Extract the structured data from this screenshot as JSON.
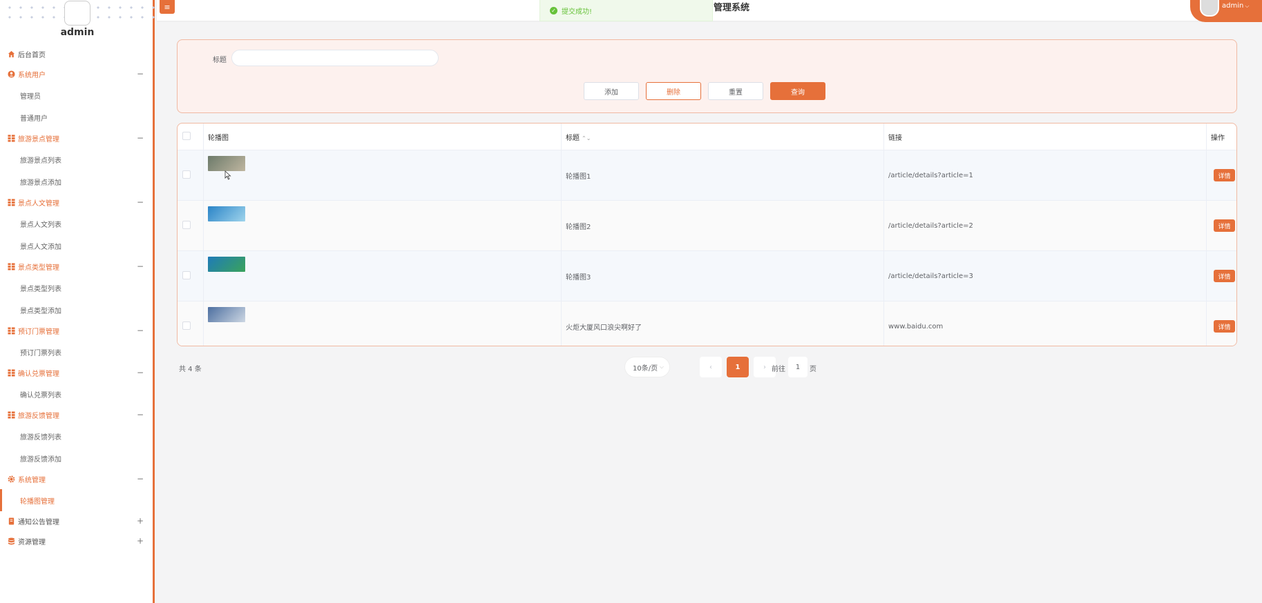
{
  "sidebar": {
    "admin_name": "admin",
    "menu": [
      {
        "type": "item",
        "label": "后台首页",
        "icon": "home-icon",
        "color": "#e6703a"
      },
      {
        "type": "group",
        "label": "系统用户",
        "icon": "user-circle-icon",
        "sign": "−"
      },
      {
        "type": "sub",
        "label": "管理员"
      },
      {
        "type": "sub",
        "label": "普通用户"
      },
      {
        "type": "group",
        "label": "旅游景点管理",
        "icon": "grid-icon",
        "sign": "−"
      },
      {
        "type": "sub",
        "label": "旅游景点列表"
      },
      {
        "type": "sub",
        "label": "旅游景点添加"
      },
      {
        "type": "group",
        "label": "景点人文管理",
        "icon": "grid-icon",
        "sign": "−"
      },
      {
        "type": "sub",
        "label": "景点人文列表"
      },
      {
        "type": "sub",
        "label": "景点人文添加"
      },
      {
        "type": "group",
        "label": "景点类型管理",
        "icon": "grid-icon",
        "sign": "−"
      },
      {
        "type": "sub",
        "label": "景点类型列表"
      },
      {
        "type": "sub",
        "label": "景点类型添加"
      },
      {
        "type": "group",
        "label": "预订门票管理",
        "icon": "grid-icon",
        "sign": "−"
      },
      {
        "type": "sub",
        "label": "预订门票列表"
      },
      {
        "type": "group",
        "label": "确认兑票管理",
        "icon": "grid-icon",
        "sign": "−"
      },
      {
        "type": "sub",
        "label": "确认兑票列表"
      },
      {
        "type": "group",
        "label": "旅游反馈管理",
        "icon": "grid-icon",
        "sign": "−"
      },
      {
        "type": "sub",
        "label": "旅游反馈列表"
      },
      {
        "type": "sub",
        "label": "旅游反馈添加"
      },
      {
        "type": "group",
        "label": "系统管理",
        "icon": "gear-icon",
        "sign": "−"
      },
      {
        "type": "sub",
        "label": "轮播图管理",
        "active": true
      },
      {
        "type": "groupdark",
        "label": "通知公告管理",
        "icon": "bookmark-icon",
        "sign": "+"
      },
      {
        "type": "groupdark",
        "label": "资源管理",
        "icon": "database-icon",
        "sign": "+"
      }
    ]
  },
  "header": {
    "menu_icon": "≡",
    "title": "管理系统",
    "toast": "提交成功!",
    "user": "admin",
    "user_caret": "⌵"
  },
  "search": {
    "label": "标题",
    "value": "",
    "buttons": {
      "add": "添加",
      "delete": "删除",
      "reset": "重置",
      "query": "查询"
    }
  },
  "table": {
    "columns": [
      "轮播图",
      "标题",
      "链接",
      "操作"
    ],
    "sort_glyph": "⌃⌄",
    "action_label": "详情",
    "rows": [
      {
        "image": "carousel-thumb-1",
        "title": "轮播图1",
        "link": "/article/details?article=1",
        "colors": [
          "#6c7a6a",
          "#bfb6a0"
        ]
      },
      {
        "image": "carousel-thumb-2",
        "title": "轮播图2",
        "link": "/article/details?article=2",
        "colors": [
          "#2b84c7",
          "#9fd4ec"
        ]
      },
      {
        "image": "carousel-thumb-3",
        "title": "轮播图3",
        "link": "/article/details?article=3",
        "colors": [
          "#1f7bb8",
          "#3aa35b"
        ]
      },
      {
        "image": "carousel-thumb-4",
        "title": "火炬大厦风口浪尖啊好了",
        "link": "www.baidu.com",
        "colors": [
          "#4d6fa0",
          "#cdd7e3"
        ]
      }
    ]
  },
  "pagination": {
    "total": "共 4 条",
    "page_size": "10条/页",
    "prev": "‹",
    "current": "1",
    "next": "›",
    "goto_prefix": "前往",
    "goto_value": "1",
    "goto_suffix": "页"
  },
  "colors": {
    "accent": "#e6703a",
    "success": "#67c23a"
  }
}
